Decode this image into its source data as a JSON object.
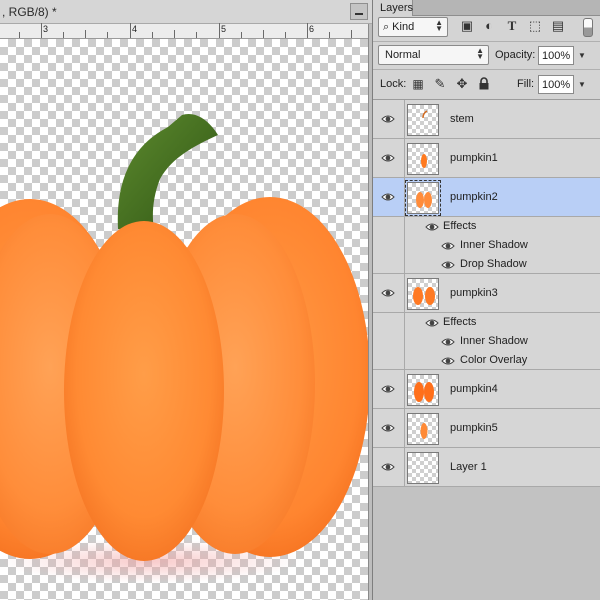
{
  "document": {
    "tab_title": ", RGB/8) *",
    "ruler_labels": [
      "3",
      "4",
      "5",
      "6"
    ]
  },
  "layers_panel": {
    "tab_label": "Layers",
    "filter": {
      "kind_label": "Kind",
      "filter_icons": [
        "image-filter-icon",
        "adjustment-filter-icon",
        "type-filter-icon",
        "shape-filter-icon",
        "smart-object-filter-icon"
      ]
    },
    "blend_mode": "Normal",
    "opacity_label": "Opacity:",
    "opacity_value": "100%",
    "lock_label": "Lock:",
    "fill_label": "Fill:",
    "fill_value": "100%",
    "layers": [
      {
        "name": "stem",
        "selected": false,
        "effects": []
      },
      {
        "name": "pumpkin1",
        "selected": false,
        "effects": []
      },
      {
        "name": "pumpkin2",
        "selected": true,
        "effects_label": "Effects",
        "effects": [
          "Inner Shadow",
          "Drop Shadow"
        ]
      },
      {
        "name": "pumpkin3",
        "selected": false,
        "effects_label": "Effects",
        "effects": [
          "Inner Shadow",
          "Color Overlay"
        ]
      },
      {
        "name": "pumpkin4",
        "selected": false,
        "effects": []
      },
      {
        "name": "pumpkin5",
        "selected": false,
        "effects": []
      },
      {
        "name": "Layer 1",
        "selected": false,
        "effects": []
      }
    ]
  },
  "colors": {
    "selection": "#b9cff6",
    "pumpkin": "#ff8a32",
    "stem": "#3f6b1c"
  }
}
